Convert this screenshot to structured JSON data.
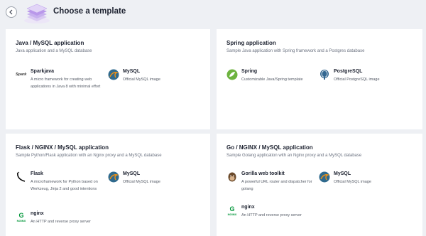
{
  "header": {
    "title": "Choose a template"
  },
  "cards": [
    {
      "title": "Java / MySQL application",
      "subtitle": "Java application and a MySQL database",
      "items": [
        {
          "name": "Sparkjava",
          "icon_label": "Spark",
          "desc": "A micro framework for creating web applications in Java 8 with minimal effort"
        },
        {
          "name": "MySQL",
          "desc": "Official MySQL image"
        }
      ]
    },
    {
      "title": "Spring application",
      "subtitle": "Sample Java application with Spring framework and a Postgres database",
      "items": [
        {
          "name": "Spring",
          "desc": "Customizable Java/Spring template"
        },
        {
          "name": "PostgreSQL",
          "desc": "Official PostgreSQL image"
        }
      ]
    },
    {
      "title": "Flask / NGINX / MySQL application",
      "subtitle": "Sample Python/Flask application with an Nginx proxy and a MySQL database",
      "items": [
        {
          "name": "Flask",
          "desc": "A microframework for Python based on Werkzeug, Jinja 2 and good intentions"
        },
        {
          "name": "MySQL",
          "desc": "Official MySQL image"
        },
        {
          "name": "nginx",
          "desc": "An HTTP and reverse proxy server"
        }
      ]
    },
    {
      "title": "Go / NGINX / MySQL application",
      "subtitle": "Sample Golang application with an Nginx proxy and a MySQL database",
      "items": [
        {
          "name": "Gorilla web toolkit",
          "desc": "A powerful URL router and dispatcher for golang"
        },
        {
          "name": "MySQL",
          "desc": "Official MySQL image"
        },
        {
          "name": "nginx",
          "desc": "An HTTP and reverse proxy server"
        }
      ]
    }
  ]
}
